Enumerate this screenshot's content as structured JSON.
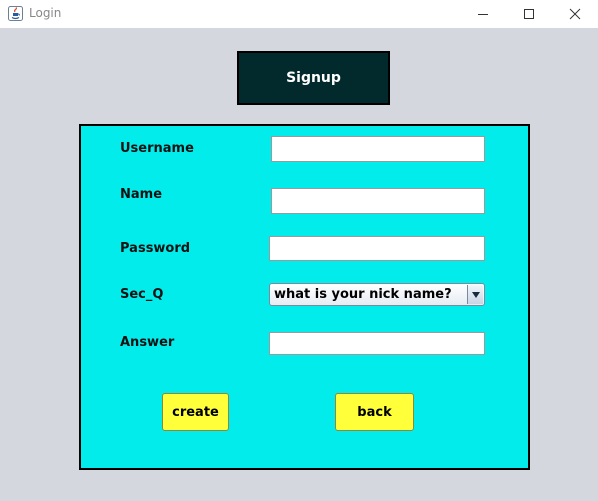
{
  "window": {
    "title": "Login",
    "titlebar_color": "#ffffff",
    "background_color": "#d5d7df"
  },
  "window_controls": [
    "minimize-icon",
    "maximize-icon",
    "close-icon"
  ],
  "header": {
    "title": "Signup",
    "background_color": "#02292b",
    "text_color": "#ffffff"
  },
  "form": {
    "background_color": "#02ecec",
    "username_label": "Username",
    "name_label": "Name",
    "password_label": "Password",
    "sec_q_label": "Sec_Q",
    "answer_label": "Answer",
    "username_value": "",
    "name_value": "",
    "password_value": "",
    "sec_q_selected": "what is your nick name?",
    "answer_value": ""
  },
  "buttons": {
    "create_label": "create",
    "back_label": "back",
    "color": "#ffff3a"
  }
}
